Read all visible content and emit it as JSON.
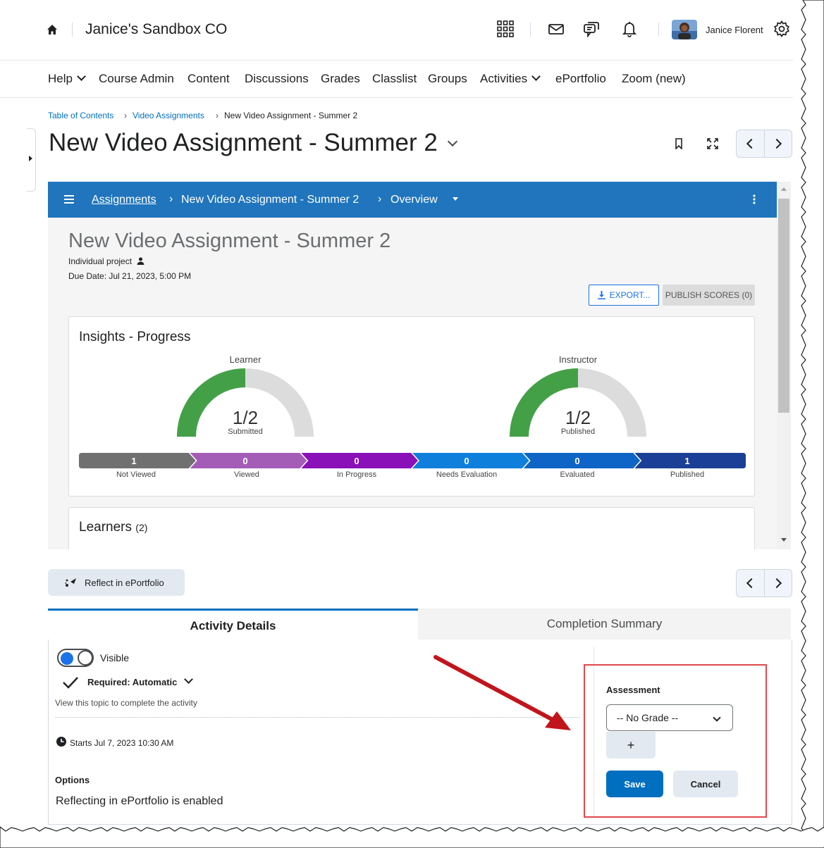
{
  "header": {
    "org_title": "Janice's Sandbox CO",
    "user_name": "Janice Florent"
  },
  "nav": {
    "items": [
      {
        "label": "Help",
        "dropdown": true
      },
      {
        "label": "Course Admin"
      },
      {
        "label": "Content"
      },
      {
        "label": "Discussions"
      },
      {
        "label": "Grades"
      },
      {
        "label": "Classlist"
      },
      {
        "label": "Groups"
      },
      {
        "label": "Activities",
        "dropdown": true
      },
      {
        "label": "ePortfolio"
      },
      {
        "label": "Zoom (new)"
      }
    ]
  },
  "breadcrumb": {
    "items": [
      "Table of Contents",
      "Video Assignments",
      "New Video Assignment - Summer 2"
    ],
    "separator": "›"
  },
  "page": {
    "title": "New Video Assignment - Summer 2"
  },
  "assignment_frame": {
    "bar": {
      "link": "Assignments",
      "crumb2": "New Video Assignment - Summer 2",
      "crumb3": "Overview",
      "sep": "›"
    },
    "title": "New Video Assignment - Summer 2",
    "project_type": "Individual project",
    "due_date": "Due Date: Jul 21, 2023, 5:00 PM",
    "export_label": "EXPORT...",
    "publish_label": "PUBLISH SCORES (0)",
    "insights": {
      "title": "Insights - Progress",
      "learner": {
        "label": "Learner",
        "value": "1/2",
        "sub": "Submitted",
        "fraction": 0.5
      },
      "instructor": {
        "label": "Instructor",
        "value": "1/2",
        "sub": "Published",
        "fraction": 0.5
      },
      "stages": [
        {
          "count": "1",
          "label": "Not Viewed",
          "color": "#707070"
        },
        {
          "count": "0",
          "label": "Viewed",
          "color": "#a45db7"
        },
        {
          "count": "0",
          "label": "In Progress",
          "color": "#8a10b8"
        },
        {
          "count": "0",
          "label": "Needs Evaluation",
          "color": "#0f7fdc"
        },
        {
          "count": "0",
          "label": "Evaluated",
          "color": "#0e65c6"
        },
        {
          "count": "1",
          "label": "Published",
          "color": "#1b3f96"
        }
      ]
    },
    "learners": {
      "title": "Learners",
      "count": "(2)"
    }
  },
  "activity": {
    "reflect_label": "Reflect in ePortfolio",
    "tabs": [
      "Activity Details",
      "Completion Summary"
    ],
    "visible_label": "Visible",
    "required_label": "Required: Automatic",
    "completion_hint": "View this topic to complete the activity",
    "starts": "Starts Jul 7, 2023 10:30 AM",
    "options_title": "Options",
    "options_text": "Reflecting in ePortfolio is enabled",
    "assessment": {
      "title": "Assessment",
      "select_value": "-- No Grade --",
      "plus": "+",
      "save": "Save",
      "cancel": "Cancel"
    }
  },
  "colors": {
    "accent": "#006fbf",
    "bar_blue": "#2075bc",
    "gauge_green": "#44a047",
    "gauge_gray": "#dcdcdc",
    "highlight_red": "#e0484c",
    "arrow_red": "#c1151c"
  }
}
